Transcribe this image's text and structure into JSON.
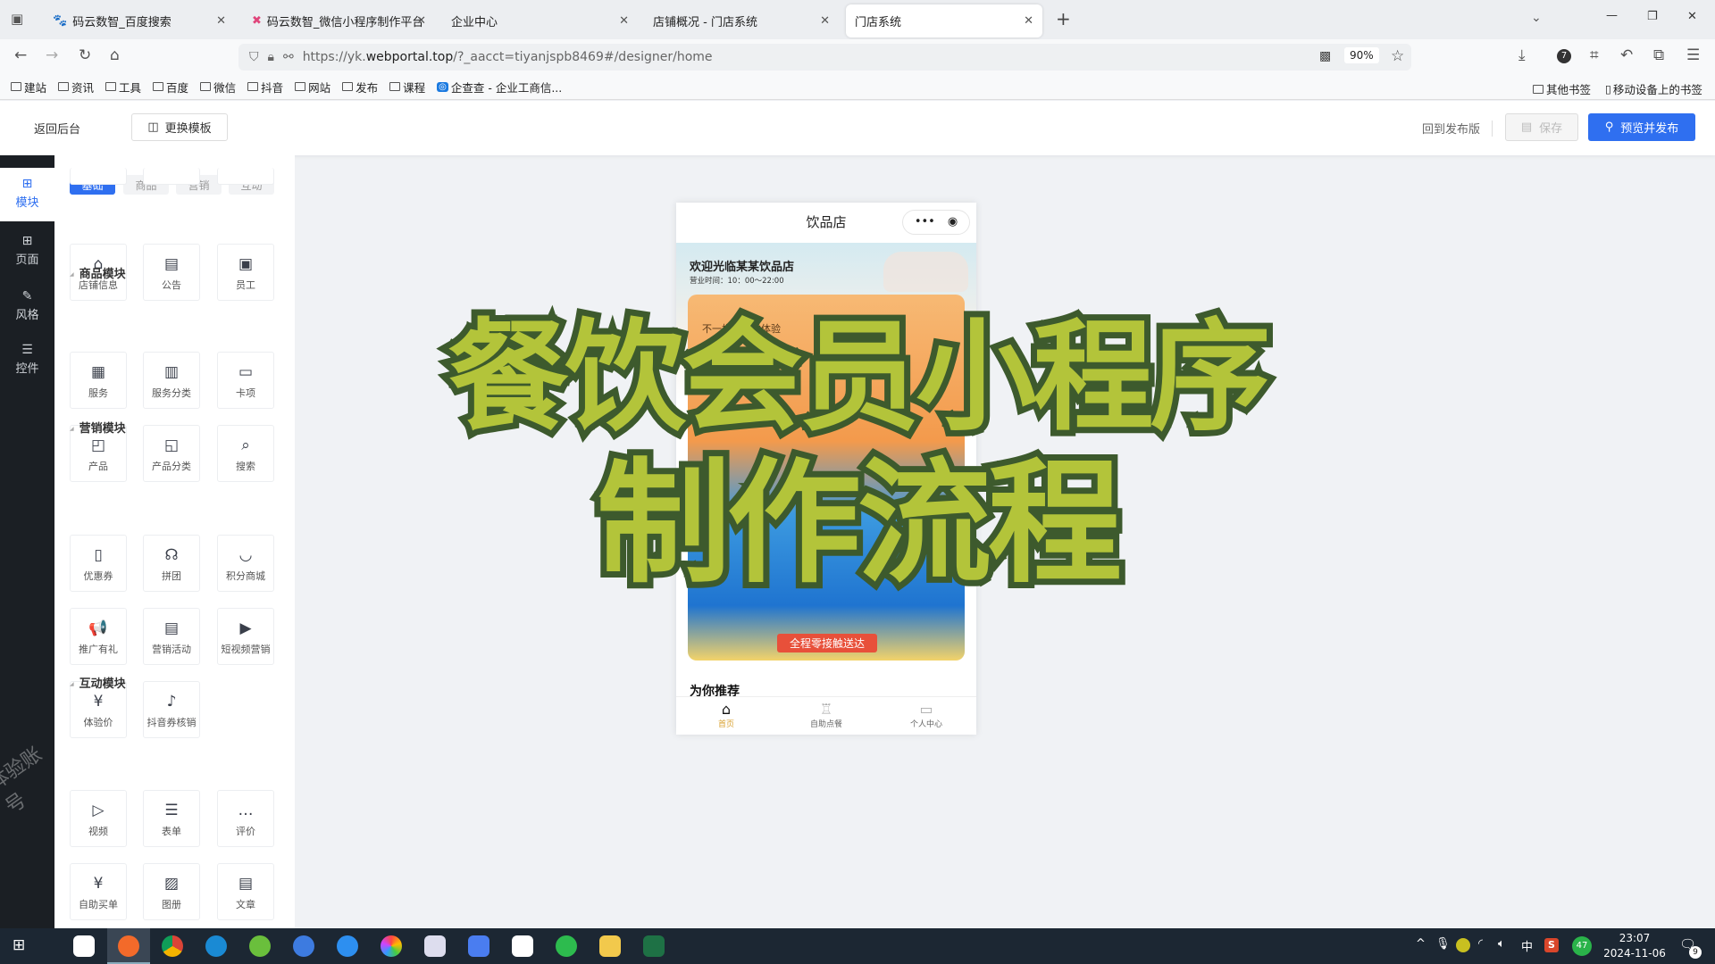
{
  "browser": {
    "tabs": [
      {
        "title": "码云数智_百度搜索",
        "icon": "paw-icon"
      },
      {
        "title": "码云数智_微信小程序制作平台",
        "icon": "x-logo-icon"
      },
      {
        "title": "企业中心"
      },
      {
        "title": "店铺概况 - 门店系统"
      },
      {
        "title": "门店系统",
        "active": true
      }
    ],
    "url_prefix": "https://yk.",
    "url_domain": "webportal.top",
    "url_rest": "/?_aacct=tiyanjspb8469#/designer/home",
    "zoom": "90%",
    "bookmarks": [
      "建站",
      "资讯",
      "工具",
      "百度",
      "微信",
      "抖音",
      "网站",
      "发布",
      "课程",
      "企查查 - 企业工商信..."
    ],
    "bookmarks_right": [
      "其他书签",
      "移动设备上的书签"
    ]
  },
  "header": {
    "back": "返回后台",
    "change_template": "更换模板",
    "back_to_published": "回到发布版",
    "save": "保存",
    "preview_publish": "预览并发布"
  },
  "sidebar": {
    "items": [
      "模块",
      "页面",
      "风格",
      "控件"
    ]
  },
  "panel": {
    "tabs": [
      "基础",
      "商品",
      "营销",
      "互动"
    ],
    "basic": [
      {
        "label": "店铺信息",
        "icon": "⌂"
      },
      {
        "label": "公告",
        "icon": "▤"
      },
      {
        "label": "员工",
        "icon": "▣"
      }
    ],
    "sections": [
      {
        "title": "商品模块",
        "items": [
          {
            "label": "服务",
            "icon": "▦"
          },
          {
            "label": "服务分类",
            "icon": "▥"
          },
          {
            "label": "卡项",
            "icon": "▭"
          },
          {
            "label": "产品",
            "icon": "◰"
          },
          {
            "label": "产品分类",
            "icon": "◱"
          },
          {
            "label": "搜索",
            "icon": "⌕"
          }
        ]
      },
      {
        "title": "营销模块",
        "items": [
          {
            "label": "优惠券",
            "icon": "▯"
          },
          {
            "label": "拼团",
            "icon": "☊"
          },
          {
            "label": "积分商城",
            "icon": "◡"
          },
          {
            "label": "推广有礼",
            "icon": "📢"
          },
          {
            "label": "营销活动",
            "icon": "▤"
          },
          {
            "label": "短视频营销",
            "icon": "▶"
          },
          {
            "label": "体验价",
            "icon": "¥"
          },
          {
            "label": "抖音券核销",
            "icon": "♪"
          }
        ]
      },
      {
        "title": "互动模块",
        "items": [
          {
            "label": "视频",
            "icon": "▷"
          },
          {
            "label": "表单",
            "icon": "☰"
          },
          {
            "label": "评价",
            "icon": "…"
          },
          {
            "label": "自助买单",
            "icon": "¥"
          },
          {
            "label": "图册",
            "icon": "▨"
          },
          {
            "label": "文章",
            "icon": "▤"
          }
        ]
      }
    ]
  },
  "phone": {
    "title": "饮品店",
    "welcome": "欢迎光临某某饮品店",
    "hours": "营业时间：10：00～22:00",
    "banner_text": "不一样的味觉体验",
    "delivery": "全程零接触送达",
    "recommend": "为你推荐",
    "tabs": [
      {
        "label": "首页",
        "active": true
      },
      {
        "label": "自助点餐"
      },
      {
        "label": "个人中心"
      }
    ]
  },
  "overlay": {
    "line1": "餐饮会员小程序",
    "line2": "制作流程",
    "fill": "#b3c43a",
    "stroke": "#3d5a2d"
  },
  "watermark": "体验账号",
  "taskbar": {
    "time": "23:07",
    "date": "2024-11-06",
    "ime": "中",
    "badge": "47",
    "notifications": "9"
  },
  "colors": {
    "accent": "#2f6ff0",
    "sidebar": "#1b1f24"
  }
}
